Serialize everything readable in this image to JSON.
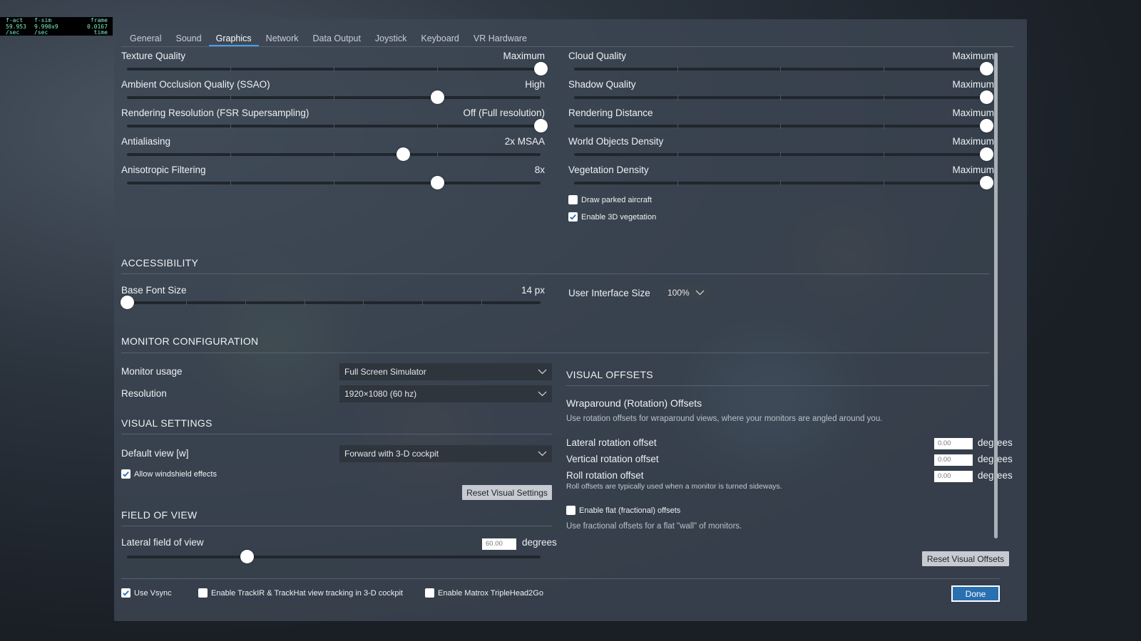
{
  "fps": {
    "c1": [
      "f-act",
      "59.953",
      "/sec"
    ],
    "c2": [
      "f-sim",
      "9.990x9",
      "/sec"
    ],
    "c3": [
      "frame",
      "0.0167",
      "time"
    ]
  },
  "tabs": [
    "General",
    "Sound",
    "Graphics",
    "Network",
    "Data Output",
    "Joystick",
    "Keyboard",
    "VR Hardware"
  ],
  "active_tab": "Graphics",
  "graphics_left": [
    {
      "label": "Texture Quality",
      "value": "Maximum",
      "level": 1.0
    },
    {
      "label": "Ambient Occlusion Quality (SSAO)",
      "value": "High",
      "level": 0.75
    },
    {
      "label": "Rendering Resolution (FSR Supersampling)",
      "value": "Off (Full resolution)",
      "level": 1.0
    },
    {
      "label": "Antialiasing",
      "value": "2x MSAA",
      "level": 0.667
    },
    {
      "label": "Anisotropic Filtering",
      "value": "8x",
      "level": 0.75
    }
  ],
  "graphics_right": [
    {
      "label": "Cloud Quality",
      "value": "Maximum",
      "level": 1.0
    },
    {
      "label": "Shadow Quality",
      "value": "Maximum",
      "level": 1.0
    },
    {
      "label": "Rendering Distance",
      "value": "Maximum",
      "level": 1.0
    },
    {
      "label": "World Objects Density",
      "value": "Maximum",
      "level": 1.0
    },
    {
      "label": "Vegetation Density",
      "value": "Maximum",
      "level": 1.0
    }
  ],
  "checkboxes_graphics": [
    {
      "label": "Draw parked aircraft",
      "checked": false
    },
    {
      "label": "Enable 3D vegetation",
      "checked": true
    }
  ],
  "accessibility": {
    "title": "ACCESSIBILITY",
    "font_label": "Base Font Size",
    "font_value": "14 px",
    "font_level": 0.0,
    "ui_size_label": "User Interface Size",
    "ui_size_value": "100%"
  },
  "monitor": {
    "title": "MONITOR CONFIGURATION",
    "usage_label": "Monitor usage",
    "usage_value": "Full Screen Simulator",
    "resolution_label": "Resolution",
    "resolution_value": "1920×1080 (60 hz)"
  },
  "visual_settings": {
    "title": "VISUAL SETTINGS",
    "default_view_label": "Default view [w]",
    "default_view_value": "Forward with 3-D cockpit",
    "windshield_label": "Allow windshield effects",
    "windshield_checked": true,
    "reset_label": "Reset Visual Settings"
  },
  "fov": {
    "title": "FIELD OF VIEW",
    "lateral_label": "Lateral field of view",
    "lateral_value": "60.00",
    "unit": "degrees",
    "level": 0.29
  },
  "visual_offsets": {
    "title": "VISUAL OFFSETS",
    "subtitle": "Wraparound (Rotation) Offsets",
    "desc": "Use rotation offsets for wraparound views, where your monitors are angled around you.",
    "rows": [
      {
        "label": "Lateral rotation offset",
        "value": "0.00",
        "unit": "degrees"
      },
      {
        "label": "Vertical rotation offset",
        "value": "0.00",
        "unit": "degrees"
      },
      {
        "label": "Roll rotation offset",
        "value": "0.00",
        "unit": "degrees"
      }
    ],
    "roll_note": "Roll offsets are typically used when a monitor is turned sideways.",
    "flat_label": "Enable flat (fractional) offsets",
    "flat_checked": false,
    "flat_desc": "Use fractional offsets for a flat \"wall\" of monitors.",
    "reset_label": "Reset Visual Offsets"
  },
  "footer": {
    "vsync": {
      "label": "Use Vsync",
      "checked": true
    },
    "trackir": {
      "label": "Enable TrackIR & TrackHat view tracking in 3-D cockpit",
      "checked": false
    },
    "matrox": {
      "label": "Enable Matrox TripleHead2Go",
      "checked": false
    },
    "done_label": "Done"
  },
  "colors": {
    "accent": "#2a6fb0",
    "tab_underline": "#4a9fe8",
    "panel": "#3e4854"
  }
}
